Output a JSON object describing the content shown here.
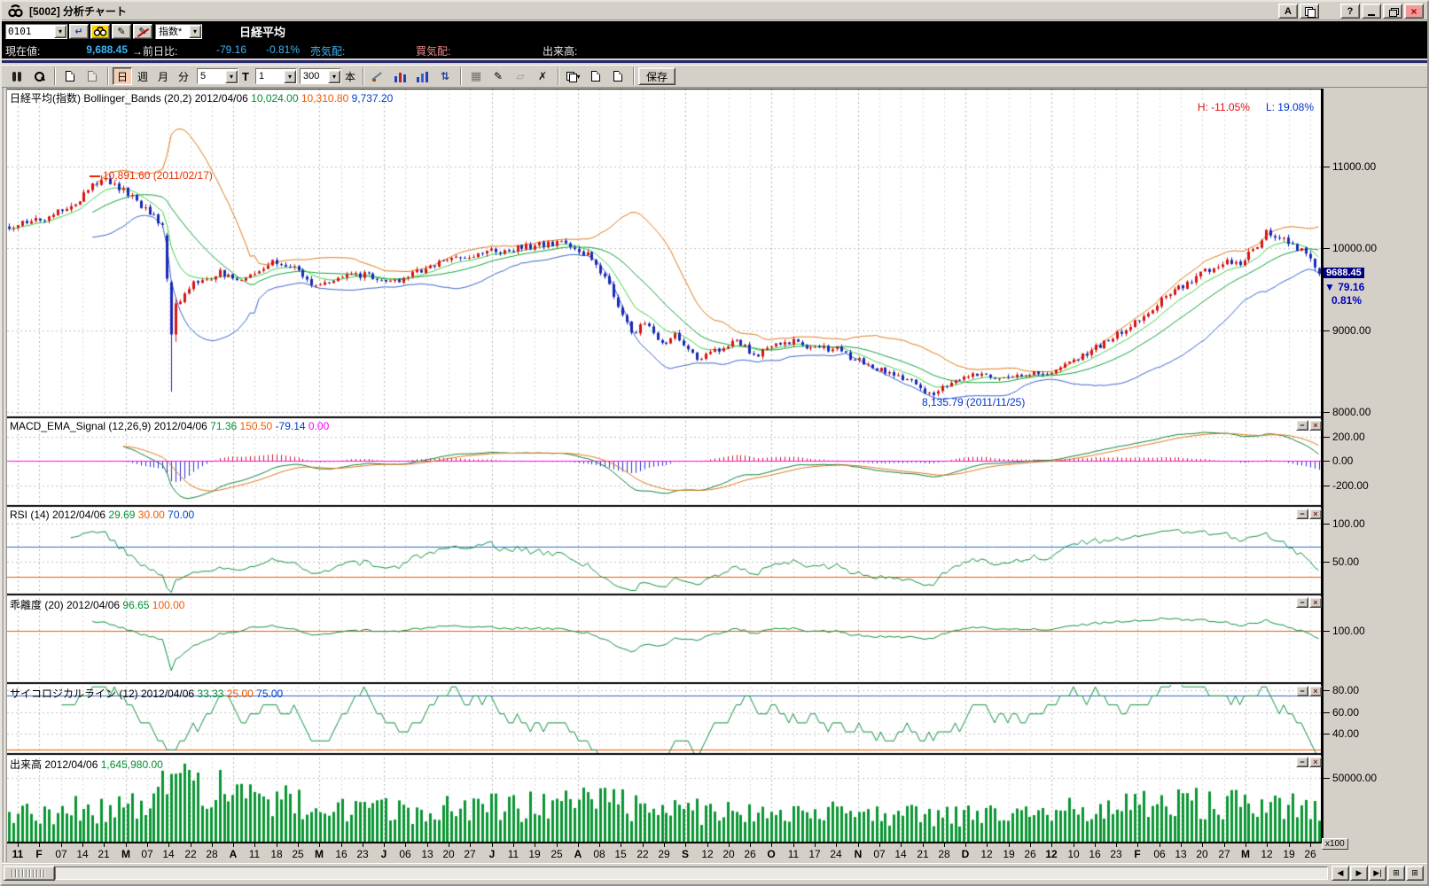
{
  "window": {
    "title": "[5002] 分析チャート",
    "buttons": {
      "font": "A",
      "help": "?",
      "close": "×"
    }
  },
  "quote_bar": {
    "code_value": "0101",
    "category_value": "指数*",
    "instrument_name": "日経平均",
    "current_label": "現在値:",
    "current_value": "9,688.45",
    "change_label": "→前日比:",
    "change_value": "-79.16",
    "change_pct": "-0.81%",
    "ask_label": "売気配:",
    "bid_label": "買気配:",
    "volume_label": "出来高:"
  },
  "toolbar": {
    "periods": [
      {
        "label": "日",
        "active": true
      },
      {
        "label": "週"
      },
      {
        "label": "月"
      },
      {
        "label": "分"
      }
    ],
    "ma_value": "5",
    "type_label": "T",
    "interval_value": "1",
    "bars_value": "300",
    "bars_unit": "本",
    "save_label": "保存"
  },
  "scroll": {
    "right_buttons": [
      "◀",
      "▶",
      "▶|",
      "⊞",
      "⊞"
    ]
  },
  "xaxis": {
    "labels": [
      {
        "t": "11",
        "m": true
      },
      {
        "t": "F",
        "m": true
      },
      {
        "t": "07"
      },
      {
        "t": "14"
      },
      {
        "t": "21"
      },
      {
        "t": "M",
        "m": true
      },
      {
        "t": "07"
      },
      {
        "t": "14"
      },
      {
        "t": "22"
      },
      {
        "t": "28"
      },
      {
        "t": "A",
        "m": true
      },
      {
        "t": "11"
      },
      {
        "t": "18"
      },
      {
        "t": "25"
      },
      {
        "t": "M",
        "m": true
      },
      {
        "t": "16"
      },
      {
        "t": "23"
      },
      {
        "t": "J",
        "m": true
      },
      {
        "t": "06"
      },
      {
        "t": "13"
      },
      {
        "t": "20"
      },
      {
        "t": "27"
      },
      {
        "t": "J",
        "m": true
      },
      {
        "t": "11"
      },
      {
        "t": "19"
      },
      {
        "t": "25"
      },
      {
        "t": "A",
        "m": true
      },
      {
        "t": "08"
      },
      {
        "t": "15"
      },
      {
        "t": "22"
      },
      {
        "t": "29"
      },
      {
        "t": "S",
        "m": true
      },
      {
        "t": "12"
      },
      {
        "t": "20"
      },
      {
        "t": "26"
      },
      {
        "t": "O",
        "m": true
      },
      {
        "t": "11"
      },
      {
        "t": "17"
      },
      {
        "t": "24"
      },
      {
        "t": "N",
        "m": true
      },
      {
        "t": "07"
      },
      {
        "t": "14"
      },
      {
        "t": "21"
      },
      {
        "t": "28"
      },
      {
        "t": "D",
        "m": true
      },
      {
        "t": "12"
      },
      {
        "t": "19"
      },
      {
        "t": "26"
      },
      {
        "t": "12",
        "m": true
      },
      {
        "t": "10"
      },
      {
        "t": "16"
      },
      {
        "t": "23"
      },
      {
        "t": "F",
        "m": true
      },
      {
        "t": "06"
      },
      {
        "t": "13"
      },
      {
        "t": "20"
      },
      {
        "t": "27"
      },
      {
        "t": "M",
        "m": true
      },
      {
        "t": "12"
      },
      {
        "t": "19"
      },
      {
        "t": "26"
      }
    ]
  },
  "chart_data": {
    "type": "candlestick",
    "instrument": "日経平均(指数)",
    "date": "2012/04/06",
    "bars": {
      "count": 300,
      "price_anchors": [
        [
          0,
          10280
        ],
        [
          0.02,
          10330
        ],
        [
          0.045,
          10480
        ],
        [
          0.065,
          10780
        ],
        [
          0.075,
          10840
        ],
        [
          0.09,
          10680
        ],
        [
          0.105,
          10460
        ],
        [
          0.117,
          10250
        ],
        [
          0.1205,
          10150
        ],
        [
          0.1238,
          8950
        ],
        [
          0.127,
          9330
        ],
        [
          0.14,
          9560
        ],
        [
          0.16,
          9700
        ],
        [
          0.18,
          9630
        ],
        [
          0.2,
          9840
        ],
        [
          0.215,
          9780
        ],
        [
          0.23,
          9560
        ],
        [
          0.25,
          9630
        ],
        [
          0.27,
          9690
        ],
        [
          0.29,
          9560
        ],
        [
          0.31,
          9700
        ],
        [
          0.33,
          9840
        ],
        [
          0.36,
          9940
        ],
        [
          0.39,
          10000
        ],
        [
          0.42,
          10070
        ],
        [
          0.44,
          9940
        ],
        [
          0.455,
          9640
        ],
        [
          0.465,
          9280
        ],
        [
          0.475,
          8960
        ],
        [
          0.485,
          9090
        ],
        [
          0.5,
          8810
        ],
        [
          0.51,
          8950
        ],
        [
          0.525,
          8660
        ],
        [
          0.54,
          8760
        ],
        [
          0.555,
          8890
        ],
        [
          0.57,
          8690
        ],
        [
          0.585,
          8820
        ],
        [
          0.6,
          8890
        ],
        [
          0.615,
          8760
        ],
        [
          0.63,
          8790
        ],
        [
          0.645,
          8650
        ],
        [
          0.66,
          8560
        ],
        [
          0.675,
          8460
        ],
        [
          0.69,
          8360
        ],
        [
          0.705,
          8210
        ],
        [
          0.72,
          8390
        ],
        [
          0.735,
          8490
        ],
        [
          0.75,
          8450
        ],
        [
          0.765,
          8410
        ],
        [
          0.78,
          8490
        ],
        [
          0.795,
          8460
        ],
        [
          0.81,
          8600
        ],
        [
          0.825,
          8750
        ],
        [
          0.84,
          8890
        ],
        [
          0.855,
          9040
        ],
        [
          0.87,
          9240
        ],
        [
          0.885,
          9440
        ],
        [
          0.9,
          9590
        ],
        [
          0.915,
          9740
        ],
        [
          0.93,
          9840
        ],
        [
          0.94,
          9800
        ],
        [
          0.95,
          9990
        ],
        [
          0.96,
          10190
        ],
        [
          0.97,
          10140
        ],
        [
          0.98,
          10060
        ],
        [
          0.99,
          9910
        ],
        [
          0.997,
          9770
        ],
        [
          1,
          9688.45
        ]
      ],
      "volume_anchors": [
        [
          0,
          21000
        ],
        [
          0.04,
          24000
        ],
        [
          0.08,
          27000
        ],
        [
          0.11,
          30000
        ],
        [
          0.121,
          52000
        ],
        [
          0.127,
          64000
        ],
        [
          0.135,
          57000
        ],
        [
          0.15,
          47000
        ],
        [
          0.17,
          40000
        ],
        [
          0.2,
          32000
        ],
        [
          0.25,
          26000
        ],
        [
          0.3,
          23000
        ],
        [
          0.35,
          26000
        ],
        [
          0.42,
          29000
        ],
        [
          0.46,
          31000
        ],
        [
          0.5,
          25000
        ],
        [
          0.55,
          23000
        ],
        [
          0.6,
          22000
        ],
        [
          0.65,
          24000
        ],
        [
          0.7,
          19000
        ],
        [
          0.75,
          20000
        ],
        [
          0.8,
          23000
        ],
        [
          0.85,
          27000
        ],
        [
          0.9,
          29000
        ],
        [
          0.94,
          31000
        ],
        [
          0.97,
          30000
        ],
        [
          1,
          26000
        ]
      ],
      "overrides": [
        {
          "t": 0.0702,
          "high": 10891.6
        },
        {
          "t": 0.1204,
          "open": 10160,
          "close": 9630,
          "high": 10190,
          "low": 9590
        },
        {
          "t": 0.1237,
          "open": 9590,
          "close": 8950,
          "high": 9610,
          "low": 8250
        },
        {
          "t": 0.1271,
          "open": 8950,
          "close": 9330,
          "high": 9400,
          "low": 8860
        },
        {
          "t": 0.7057,
          "low": 8135.79,
          "close": 8210
        },
        {
          "t": 0.9967,
          "close": 9767.61
        },
        {
          "t": 1,
          "open": 9757,
          "close": 9688.45,
          "high": 9769,
          "low": 9663,
          "volume": 16459.8
        }
      ]
    },
    "panels": [
      {
        "id": "main",
        "title_segments": [
          {
            "text": "日経平均(指数) Bollinger_Bands (20,2) 2012/04/06 ",
            "color": "#000000"
          },
          {
            "text": "10,024.00 ",
            "color": "#009030"
          },
          {
            "text": "10,310.80 ",
            "color": "#f05a00"
          },
          {
            "text": "9,737.20",
            "color": "#0040cc"
          }
        ],
        "range": [
          7950,
          11950
        ],
        "ticks": [
          {
            "value": 11000,
            "label": "11000.00"
          },
          {
            "value": 10000,
            "label": "10000.00"
          },
          {
            "value": 9000,
            "label": "9000.00"
          },
          {
            "value": 8000,
            "label": "8000.00"
          }
        ],
        "hl_badges": [
          {
            "text": "H: -11.05%",
            "color": "#dd1111"
          },
          {
            "text": "L: 19.08%",
            "color": "#0033cc"
          }
        ],
        "annotations": [
          {
            "text": "10,891.60 (2011/02/17)",
            "color": "#e83000",
            "t": 0.0702,
            "value": 10891.6,
            "dash": true,
            "dx": 4,
            "dy": -7
          },
          {
            "text": "8,135.79 (2011/11/25)",
            "color": "#0033cc",
            "t": 0.7057,
            "value": 8135.79,
            "dash": false,
            "dx": -14,
            "dy": -6
          }
        ],
        "price_tag": {
          "value": 9688.45,
          "value_text": "9688.45",
          "change_text": "79.16",
          "pct_text": "0.81%",
          "bg": "#000080",
          "fg": "#ffffff",
          "text_color": "#0000bb"
        },
        "series": [
          {
            "name": "bollinger_upper",
            "color": "#e07818"
          },
          {
            "name": "bollinger_lower",
            "color": "#3864cc"
          },
          {
            "name": "ma20",
            "color": "#10a038"
          },
          {
            "name": "ema9",
            "color": "#3fd24a"
          },
          {
            "name": "candle_up",
            "color": "#d41414"
          },
          {
            "name": "candle_down",
            "color": "#1a28b4"
          }
        ]
      },
      {
        "id": "macd",
        "title_segments": [
          {
            "text": "MACD_EMA_Signal (12,26,9) 2012/04/06 ",
            "color": "#000000"
          },
          {
            "text": "71.36 ",
            "color": "#009030"
          },
          {
            "text": "150.50 ",
            "color": "#f05a00"
          },
          {
            "text": "-79.14 ",
            "color": "#0040cc"
          },
          {
            "text": "0.00",
            "color": "#ff00ff"
          }
        ],
        "range": [
          -360,
          350
        ],
        "ticks": [
          {
            "value": 200,
            "label": "200.00"
          },
          {
            "value": 0,
            "label": "0.00"
          },
          {
            "value": -200,
            "label": "-200.00"
          }
        ],
        "guides": [
          {
            "value": 0,
            "color": "#ff00ff"
          }
        ],
        "window_buttons": true,
        "series": [
          {
            "name": "macd",
            "color": "#108038"
          },
          {
            "name": "signal",
            "color": "#e07818"
          },
          {
            "name": "histogram_positive",
            "color": "#cc2020"
          },
          {
            "name": "histogram_negative",
            "color": "#2830cc"
          },
          {
            "name": "zero_line",
            "color": "#ff00ff"
          }
        ]
      },
      {
        "id": "rsi",
        "title_segments": [
          {
            "text": "RSI (14) 2012/04/06 ",
            "color": "#000000"
          },
          {
            "text": "29.69 ",
            "color": "#009030"
          },
          {
            "text": "30.00 ",
            "color": "#f05a00"
          },
          {
            "text": "70.00",
            "color": "#0040cc"
          }
        ],
        "range": [
          8,
          122
        ],
        "ticks": [
          {
            "value": 100,
            "label": "100.00"
          },
          {
            "value": 50,
            "label": "50.00"
          }
        ],
        "guides": [
          {
            "value": 70,
            "color": "#2d6bd0"
          },
          {
            "value": 30,
            "color": "#f05a00"
          }
        ],
        "window_buttons": true,
        "series": [
          {
            "name": "rsi",
            "color": "#109040"
          }
        ]
      },
      {
        "id": "dev",
        "title_segments": [
          {
            "text": "乖離度 (20) 2012/04/06 ",
            "color": "#000000"
          },
          {
            "text": "96.65 ",
            "color": "#009030"
          },
          {
            "text": "100.00",
            "color": "#f05a00"
          }
        ],
        "range": [
          81,
          113
        ],
        "ticks": [
          {
            "value": 100,
            "label": "100.00"
          }
        ],
        "guides": [
          {
            "value": 100,
            "color": "#f05a00"
          }
        ],
        "window_buttons": true,
        "series": [
          {
            "name": "kairi",
            "color": "#109040"
          }
        ]
      },
      {
        "id": "psy",
        "title_segments": [
          {
            "text": "サイコロジカルライン (12) 2012/04/06 ",
            "color": "#000000"
          },
          {
            "text": "33.33 ",
            "color": "#009030"
          },
          {
            "text": "25.00 ",
            "color": "#f05a00"
          },
          {
            "text": "75.00",
            "color": "#0040cc"
          }
        ],
        "range": [
          22,
          86
        ],
        "ticks": [
          {
            "value": 80,
            "label": "80.00"
          },
          {
            "value": 60,
            "label": "60.00"
          },
          {
            "value": 40,
            "label": "40.00"
          }
        ],
        "guides": [
          {
            "value": 75,
            "color": "#2d6bd0"
          },
          {
            "value": 25,
            "color": "#f05a00"
          }
        ],
        "window_buttons": true,
        "series": [
          {
            "name": "psychological",
            "color": "#109040"
          }
        ]
      },
      {
        "id": "vol",
        "title_segments": [
          {
            "text": "出来高 2012/04/06 ",
            "color": "#000000"
          },
          {
            "text": "1,645,980.00",
            "color": "#009030"
          }
        ],
        "range": [
          0,
          68000
        ],
        "ticks": [
          {
            "value": 50000,
            "label": "50000.00"
          }
        ],
        "guides": [],
        "unit_badge": "x100",
        "window_buttons": true,
        "series": [
          {
            "name": "volume",
            "color": "#0a9632"
          }
        ]
      }
    ]
  }
}
